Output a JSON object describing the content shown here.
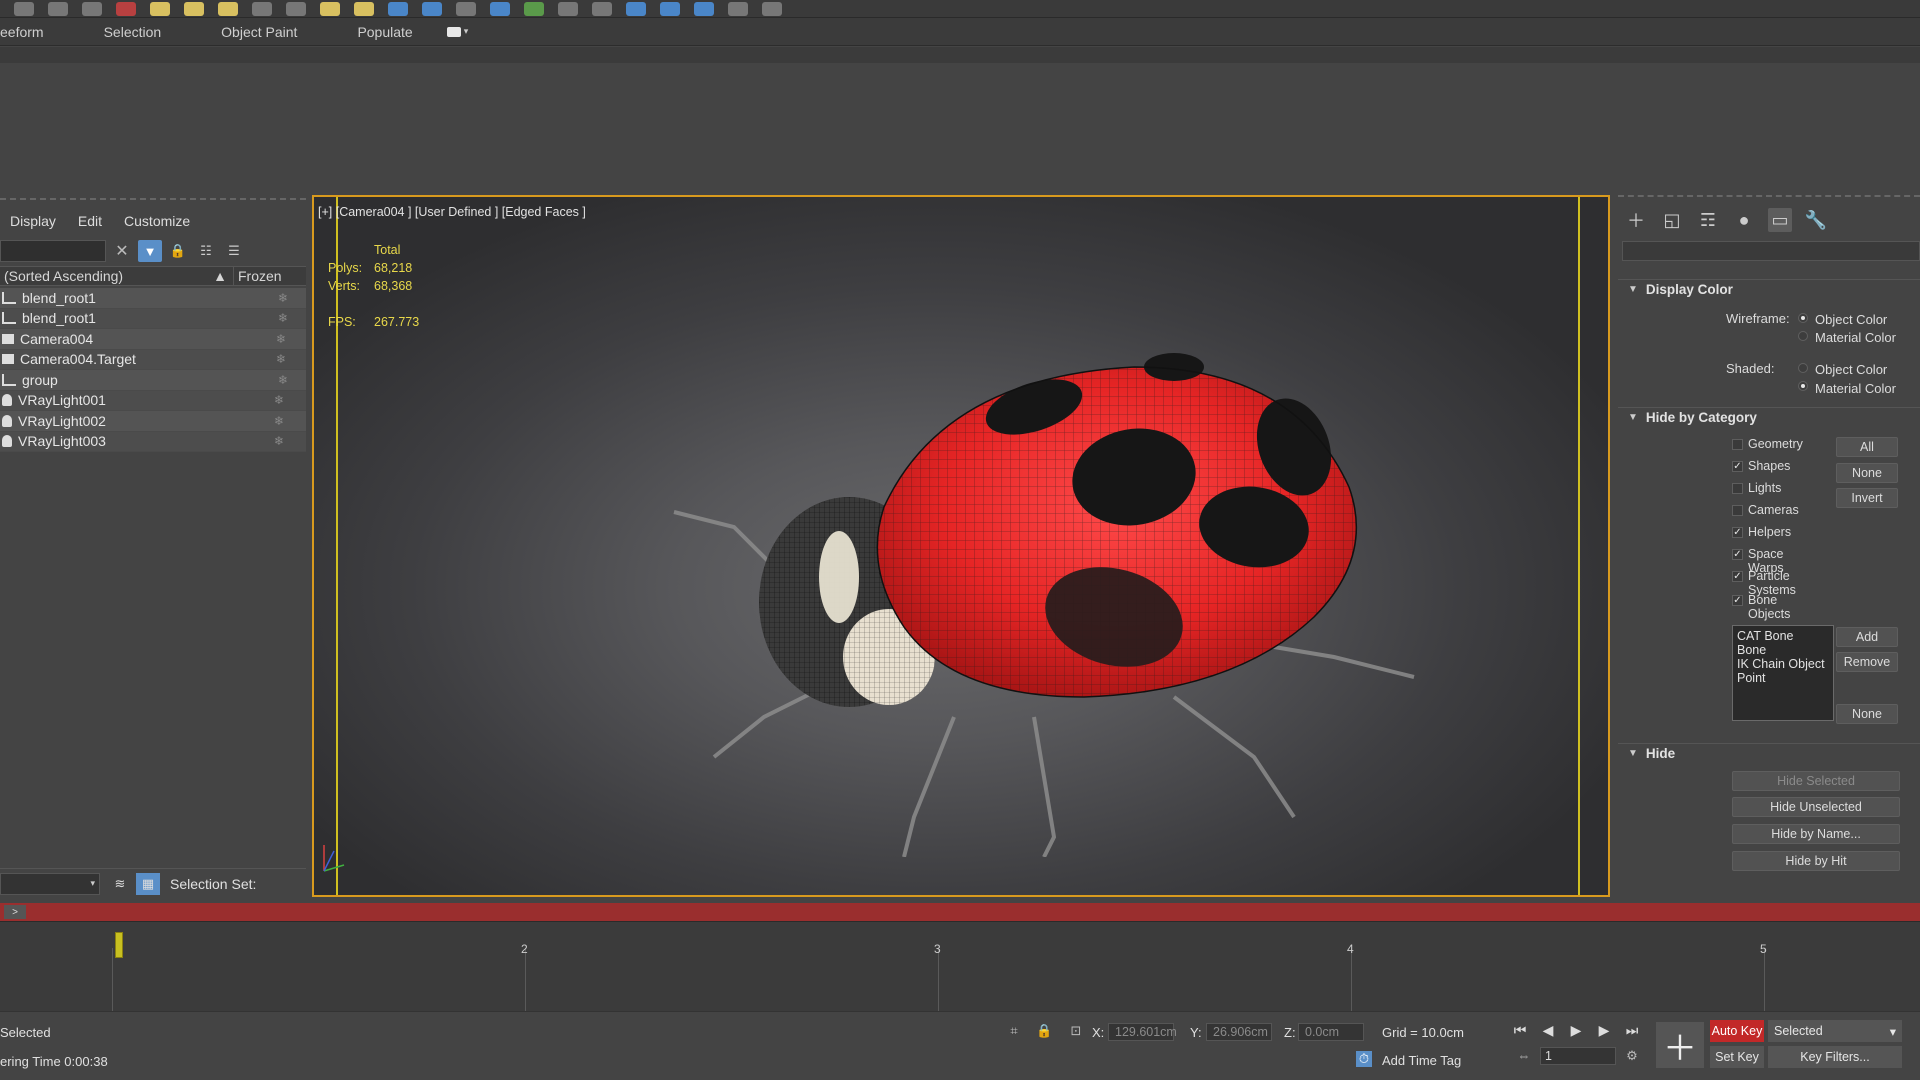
{
  "ribbon": {
    "tabs": [
      "eeform",
      "Selection",
      "Object Paint",
      "Populate"
    ]
  },
  "explorer": {
    "menu": [
      "Display",
      "Edit",
      "Customize"
    ],
    "header": {
      "name": "(Sorted Ascending)",
      "sort_indicator": "▲",
      "frozen": "Frozen"
    },
    "rows": [
      {
        "name": "blend_root1",
        "icon": "shape-icon"
      },
      {
        "name": "blend_root1",
        "icon": "shape-icon"
      },
      {
        "name": "Camera004",
        "icon": "camera-icon"
      },
      {
        "name": "Camera004.Target",
        "icon": "camera-icon"
      },
      {
        "name": "group",
        "icon": "shape-icon"
      },
      {
        "name": "VRayLight001",
        "icon": "light-icon"
      },
      {
        "name": "VRayLight002",
        "icon": "light-icon"
      },
      {
        "name": "VRayLight003",
        "icon": "light-icon"
      }
    ],
    "frozen_glyph": "❄",
    "selection_set_label": "Selection Set:"
  },
  "viewport": {
    "label": "[+] [Camera004 ] [User Defined ] [Edged Faces ]",
    "stats": {
      "total_label": "Total",
      "polys_label": "Polys:",
      "polys_value": "68,218",
      "verts_label": "Verts:",
      "verts_value": "68,368",
      "fps_label": "FPS:",
      "fps_value": "267.773"
    },
    "accent": "#d89a1e",
    "safe_frame_color": "#d0c020"
  },
  "command_panel": {
    "display_color": {
      "title": "Display Color",
      "wireframe_label": "Wireframe:",
      "wireframe_options": [
        "Object Color",
        "Material Color"
      ],
      "wireframe_selected": 0,
      "shaded_label": "Shaded:",
      "shaded_options": [
        "Object Color",
        "Material Color"
      ],
      "shaded_selected": 1
    },
    "hide_by_category": {
      "title": "Hide by Category",
      "categories": [
        {
          "label": "Geometry",
          "checked": false
        },
        {
          "label": "Shapes",
          "checked": true
        },
        {
          "label": "Lights",
          "checked": false
        },
        {
          "label": "Cameras",
          "checked": false
        },
        {
          "label": "Helpers",
          "checked": true
        },
        {
          "label": "Space Warps",
          "checked": true
        },
        {
          "label": "Particle Systems",
          "checked": true
        },
        {
          "label": "Bone Objects",
          "checked": true
        }
      ],
      "buttons": [
        "All",
        "None",
        "Invert"
      ],
      "list_items": [
        "CAT Bone",
        "Bone",
        "IK Chain Object",
        "Point"
      ],
      "list_buttons": [
        "Add",
        "Remove",
        "None"
      ]
    },
    "hide": {
      "title": "Hide",
      "buttons": [
        "Hide Selected",
        "Hide Unselected",
        "Hide by Name...",
        "Hide by Hit"
      ]
    }
  },
  "timeline": {
    "slider_button": ">",
    "frame_numbers": [
      "2",
      "3",
      "4",
      "5"
    ],
    "current_frame_fraction": 0.112
  },
  "statusbar": {
    "selection_text": "Selected",
    "render_time": "ering Time  0:00:38",
    "x_label": "X:",
    "x_value": "129.601cm",
    "y_label": "Y:",
    "y_value": "26.906cm",
    "z_label": "Z:",
    "z_value": "0.0cm",
    "grid": "Grid = 10.0cm",
    "add_time_tag": "Add Time Tag",
    "auto_key": "Auto Key",
    "set_key": "Set Key",
    "selected_dd": "Selected",
    "key_filters": "Key Filters...",
    "frame_value": "1",
    "auto_key_color": "#c22828"
  }
}
